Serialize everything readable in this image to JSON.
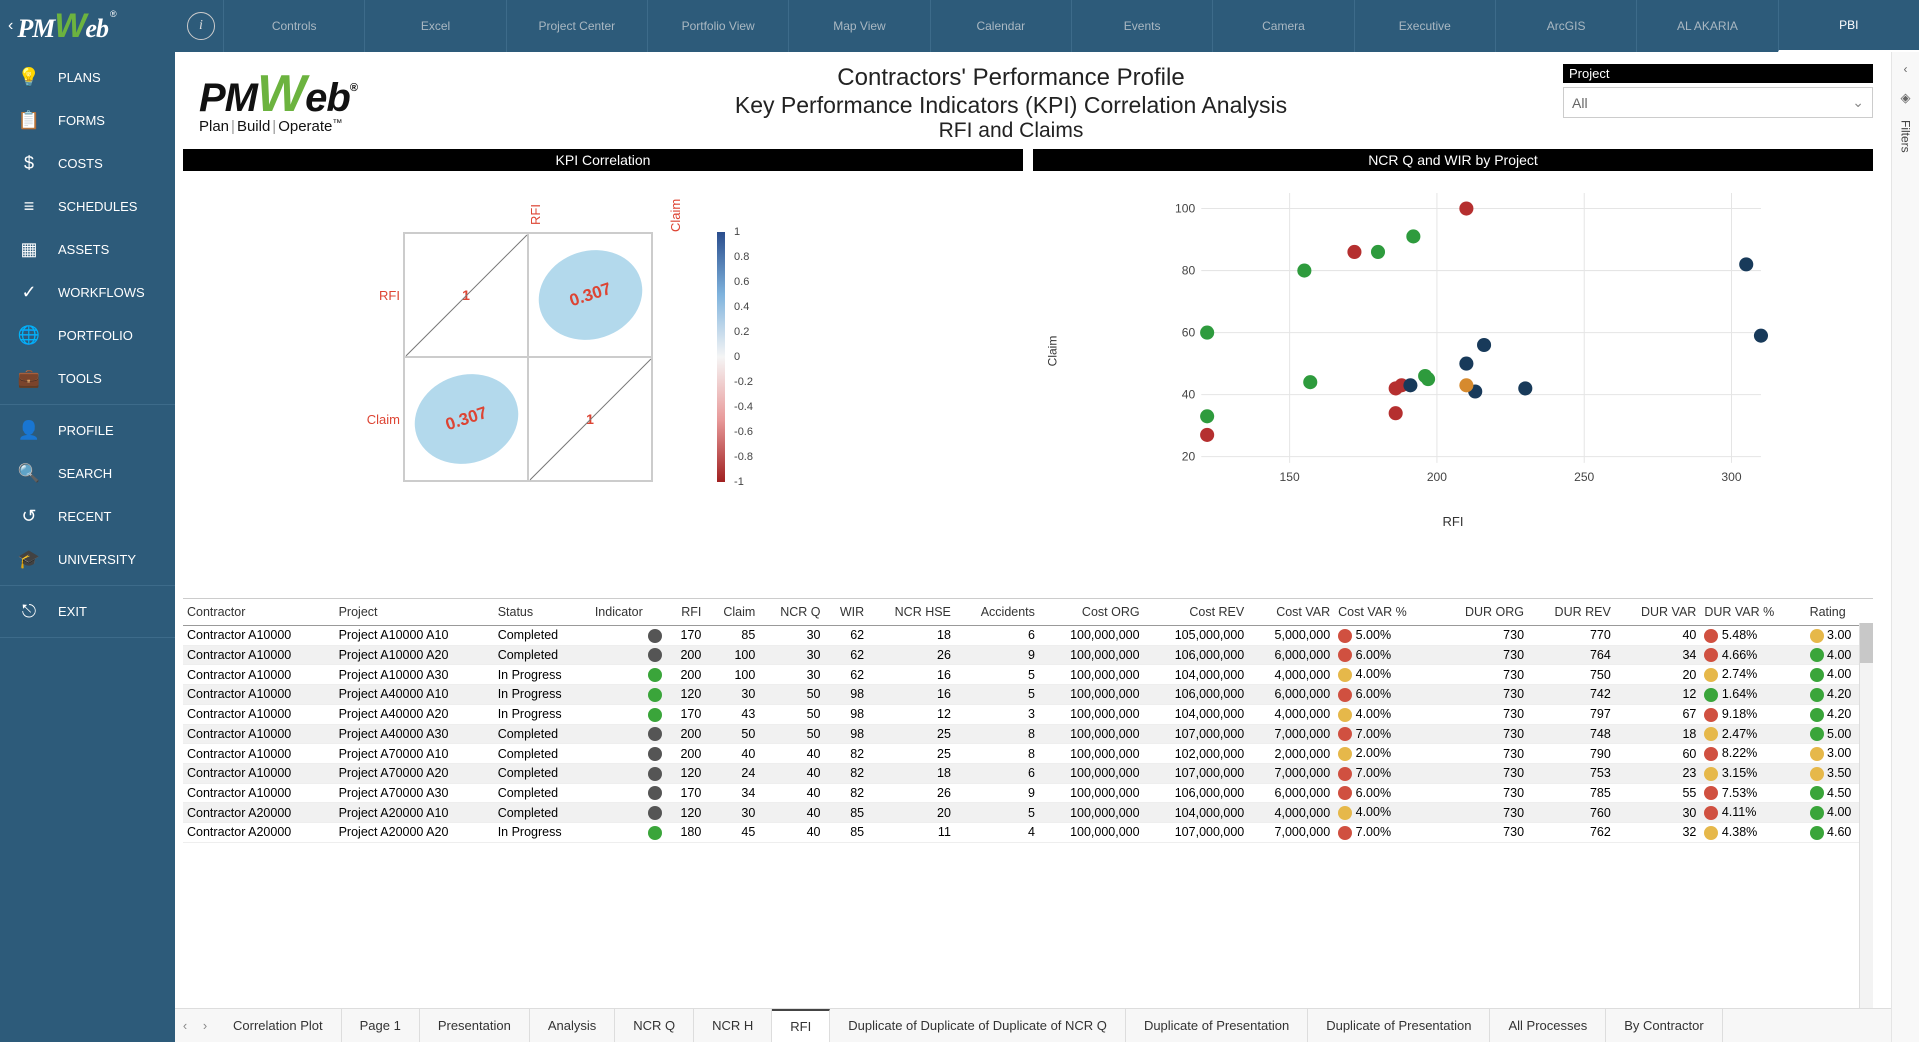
{
  "topnav": [
    "Controls",
    "Excel",
    "Project Center",
    "Portfolio View",
    "Map View",
    "Calendar",
    "Events",
    "Camera",
    "Executive",
    "ArcGIS",
    "AL AKARIA",
    "PBI"
  ],
  "topnav_active": "PBI",
  "sidebar": {
    "group1": [
      "PLANS",
      "FORMS",
      "COSTS",
      "SCHEDULES",
      "ASSETS",
      "WORKFLOWS",
      "PORTFOLIO",
      "TOOLS"
    ],
    "group2": [
      "PROFILE",
      "SEARCH",
      "RECENT",
      "UNIVERSITY"
    ],
    "group3": [
      "EXIT"
    ]
  },
  "sidebar_icons": {
    "PLANS": "lightbulb-icon",
    "FORMS": "clipboard-icon",
    "COSTS": "dollar-icon",
    "SCHEDULES": "bars-icon",
    "ASSETS": "grid-icon",
    "WORKFLOWS": "check-icon",
    "PORTFOLIO": "globe-icon",
    "TOOLS": "briefcase-icon",
    "PROFILE": "user-icon",
    "SEARCH": "search-icon",
    "RECENT": "history-icon",
    "UNIVERSITY": "graduate-icon",
    "EXIT": "exit-icon"
  },
  "header": {
    "logo_tagline_parts": [
      "Plan",
      "Build",
      "Operate"
    ],
    "logo_tagline_tm": "™",
    "title_l1": "Contractors' Performance Profile",
    "title_l2": "Key Performance Indicators (KPI) Correlation Analysis",
    "title_l3": "RFI and Claims",
    "filter_label": "Project",
    "filter_value": "All"
  },
  "filters_rail_label": "Filters",
  "chart_left_title": "KPI Correlation",
  "chart_right_title": "NCR Q and WIR by Project",
  "chart_data": [
    {
      "type": "heatmap",
      "title": "KPI Correlation",
      "labels": [
        "RFI",
        "Claim"
      ],
      "matrix": [
        [
          1,
          0.307
        ],
        [
          0.307,
          1
        ]
      ],
      "colorbar_ticks": [
        "1",
        "0.8",
        "0.6",
        "0.4",
        "0.2",
        "0",
        "-0.2",
        "-0.4",
        "-0.6",
        "-0.8",
        "-1"
      ]
    },
    {
      "type": "scatter",
      "title": "NCR Q and WIR by Project",
      "xlabel": "RFI",
      "ylabel": "Claim",
      "xticks": [
        150,
        200,
        250,
        300
      ],
      "yticks": [
        20,
        40,
        60,
        80,
        100
      ],
      "xlim": [
        120,
        310
      ],
      "ylim": [
        18,
        105
      ],
      "series": [
        {
          "name": "green",
          "color": "#2e9b3d",
          "points": [
            [
              122,
              60
            ],
            [
              122,
              33
            ],
            [
              155,
              80
            ],
            [
              157,
              44
            ],
            [
              180,
              86
            ],
            [
              192,
              91
            ],
            [
              196,
              46
            ],
            [
              197,
              45
            ]
          ]
        },
        {
          "name": "red",
          "color": "#b52f2f",
          "points": [
            [
              122,
              27
            ],
            [
              172,
              86
            ],
            [
              186,
              42
            ],
            [
              188,
              43
            ],
            [
              186,
              34
            ],
            [
              210,
              100
            ]
          ]
        },
        {
          "name": "navy",
          "color": "#183a5a",
          "points": [
            [
              191,
              43
            ],
            [
              210,
              50
            ],
            [
              213,
              41
            ],
            [
              216,
              56
            ],
            [
              230,
              42
            ],
            [
              305,
              82
            ],
            [
              310,
              59
            ]
          ]
        },
        {
          "name": "orange",
          "color": "#d68a2e",
          "points": [
            [
              210,
              43
            ]
          ]
        }
      ]
    }
  ],
  "table": {
    "columns": [
      "Contractor",
      "Project",
      "Status",
      "Indicator",
      "RFI",
      "Claim",
      "NCR Q",
      "WIR",
      "NCR HSE",
      "Accidents",
      "Cost ORG",
      "Cost REV",
      "Cost VAR",
      "Cost VAR %",
      "DUR ORG",
      "DUR REV",
      "DUR VAR",
      "DUR VAR %",
      "Rating"
    ],
    "align": [
      "l",
      "l",
      "l",
      "c",
      "r",
      "r",
      "r",
      "r",
      "r",
      "r",
      "r",
      "r",
      "r",
      "l",
      "r",
      "r",
      "r",
      "l",
      "l"
    ],
    "rows": [
      {
        "Contractor": "Contractor A10000",
        "Project": "Project A10000 A10",
        "Status": "Completed",
        "Indicator": "#555",
        "RFI": 170,
        "Claim": 85,
        "NCR Q": 30,
        "WIR": 62,
        "NCR HSE": 18,
        "Accidents": 6,
        "Cost ORG": "100,000,000",
        "Cost REV": "105,000,000",
        "Cost VAR": "5,000,000",
        "Cost VAR %": "5.00%",
        "cvc": "#d05040",
        "DUR ORG": 730,
        "DUR REV": 770,
        "DUR VAR": 40,
        "DUR VAR %": "5.48%",
        "dvc": "#d05040",
        "Rating": "3.00",
        "rc": "#e6b84a"
      },
      {
        "Contractor": "Contractor A10000",
        "Project": "Project A10000 A20",
        "Status": "Completed",
        "Indicator": "#555",
        "RFI": 200,
        "Claim": 100,
        "NCR Q": 30,
        "WIR": 62,
        "NCR HSE": 26,
        "Accidents": 9,
        "Cost ORG": "100,000,000",
        "Cost REV": "106,000,000",
        "Cost VAR": "6,000,000",
        "Cost VAR %": "6.00%",
        "cvc": "#d05040",
        "DUR ORG": 730,
        "DUR REV": 764,
        "DUR VAR": 34,
        "DUR VAR %": "4.66%",
        "dvc": "#d05040",
        "Rating": "4.00",
        "rc": "#3aa53a"
      },
      {
        "Contractor": "Contractor A10000",
        "Project": "Project A10000 A30",
        "Status": "In Progress",
        "Indicator": "#3aa53a",
        "RFI": 200,
        "Claim": 100,
        "NCR Q": 30,
        "WIR": 62,
        "NCR HSE": 16,
        "Accidents": 5,
        "Cost ORG": "100,000,000",
        "Cost REV": "104,000,000",
        "Cost VAR": "4,000,000",
        "Cost VAR %": "4.00%",
        "cvc": "#e6b84a",
        "DUR ORG": 730,
        "DUR REV": 750,
        "DUR VAR": 20,
        "DUR VAR %": "2.74%",
        "dvc": "#e6b84a",
        "Rating": "4.00",
        "rc": "#3aa53a"
      },
      {
        "Contractor": "Contractor A10000",
        "Project": "Project A40000 A10",
        "Status": "In Progress",
        "Indicator": "#3aa53a",
        "RFI": 120,
        "Claim": 30,
        "NCR Q": 50,
        "WIR": 98,
        "NCR HSE": 16,
        "Accidents": 5,
        "Cost ORG": "100,000,000",
        "Cost REV": "106,000,000",
        "Cost VAR": "6,000,000",
        "Cost VAR %": "6.00%",
        "cvc": "#d05040",
        "DUR ORG": 730,
        "DUR REV": 742,
        "DUR VAR": 12,
        "DUR VAR %": "1.64%",
        "dvc": "#3aa53a",
        "Rating": "4.20",
        "rc": "#3aa53a"
      },
      {
        "Contractor": "Contractor A10000",
        "Project": "Project A40000 A20",
        "Status": "In Progress",
        "Indicator": "#3aa53a",
        "RFI": 170,
        "Claim": 43,
        "NCR Q": 50,
        "WIR": 98,
        "NCR HSE": 12,
        "Accidents": 3,
        "Cost ORG": "100,000,000",
        "Cost REV": "104,000,000",
        "Cost VAR": "4,000,000",
        "Cost VAR %": "4.00%",
        "cvc": "#e6b84a",
        "DUR ORG": 730,
        "DUR REV": 797,
        "DUR VAR": 67,
        "DUR VAR %": "9.18%",
        "dvc": "#d05040",
        "Rating": "4.20",
        "rc": "#3aa53a"
      },
      {
        "Contractor": "Contractor A10000",
        "Project": "Project A40000 A30",
        "Status": "Completed",
        "Indicator": "#555",
        "RFI": 200,
        "Claim": 50,
        "NCR Q": 50,
        "WIR": 98,
        "NCR HSE": 25,
        "Accidents": 8,
        "Cost ORG": "100,000,000",
        "Cost REV": "107,000,000",
        "Cost VAR": "7,000,000",
        "Cost VAR %": "7.00%",
        "cvc": "#d05040",
        "DUR ORG": 730,
        "DUR REV": 748,
        "DUR VAR": 18,
        "DUR VAR %": "2.47%",
        "dvc": "#e6b84a",
        "Rating": "5.00",
        "rc": "#3aa53a"
      },
      {
        "Contractor": "Contractor A10000",
        "Project": "Project A70000 A10",
        "Status": "Completed",
        "Indicator": "#555",
        "RFI": 200,
        "Claim": 40,
        "NCR Q": 40,
        "WIR": 82,
        "NCR HSE": 25,
        "Accidents": 8,
        "Cost ORG": "100,000,000",
        "Cost REV": "102,000,000",
        "Cost VAR": "2,000,000",
        "Cost VAR %": "2.00%",
        "cvc": "#e6b84a",
        "DUR ORG": 730,
        "DUR REV": 790,
        "DUR VAR": 60,
        "DUR VAR %": "8.22%",
        "dvc": "#d05040",
        "Rating": "3.00",
        "rc": "#e6b84a"
      },
      {
        "Contractor": "Contractor A10000",
        "Project": "Project A70000 A20",
        "Status": "Completed",
        "Indicator": "#555",
        "RFI": 120,
        "Claim": 24,
        "NCR Q": 40,
        "WIR": 82,
        "NCR HSE": 18,
        "Accidents": 6,
        "Cost ORG": "100,000,000",
        "Cost REV": "107,000,000",
        "Cost VAR": "7,000,000",
        "Cost VAR %": "7.00%",
        "cvc": "#d05040",
        "DUR ORG": 730,
        "DUR REV": 753,
        "DUR VAR": 23,
        "DUR VAR %": "3.15%",
        "dvc": "#e6b84a",
        "Rating": "3.50",
        "rc": "#e6b84a"
      },
      {
        "Contractor": "Contractor A10000",
        "Project": "Project A70000 A30",
        "Status": "Completed",
        "Indicator": "#555",
        "RFI": 170,
        "Claim": 34,
        "NCR Q": 40,
        "WIR": 82,
        "NCR HSE": 26,
        "Accidents": 9,
        "Cost ORG": "100,000,000",
        "Cost REV": "106,000,000",
        "Cost VAR": "6,000,000",
        "Cost VAR %": "6.00%",
        "cvc": "#d05040",
        "DUR ORG": 730,
        "DUR REV": 785,
        "DUR VAR": 55,
        "DUR VAR %": "7.53%",
        "dvc": "#d05040",
        "Rating": "4.50",
        "rc": "#3aa53a"
      },
      {
        "Contractor": "Contractor A20000",
        "Project": "Project A20000 A10",
        "Status": "Completed",
        "Indicator": "#555",
        "RFI": 120,
        "Claim": 30,
        "NCR Q": 40,
        "WIR": 85,
        "NCR HSE": 20,
        "Accidents": 5,
        "Cost ORG": "100,000,000",
        "Cost REV": "104,000,000",
        "Cost VAR": "4,000,000",
        "Cost VAR %": "4.00%",
        "cvc": "#e6b84a",
        "DUR ORG": 730,
        "DUR REV": 760,
        "DUR VAR": 30,
        "DUR VAR %": "4.11%",
        "dvc": "#d05040",
        "Rating": "4.00",
        "rc": "#3aa53a"
      },
      {
        "Contractor": "Contractor A20000",
        "Project": "Project A20000 A20",
        "Status": "In Progress",
        "Indicator": "#3aa53a",
        "RFI": 180,
        "Claim": 45,
        "NCR Q": 40,
        "WIR": 85,
        "NCR HSE": 11,
        "Accidents": 4,
        "Cost ORG": "100,000,000",
        "Cost REV": "107,000,000",
        "Cost VAR": "7,000,000",
        "Cost VAR %": "7.00%",
        "cvc": "#d05040",
        "DUR ORG": 730,
        "DUR REV": 762,
        "DUR VAR": 32,
        "DUR VAR %": "4.38%",
        "dvc": "#e6b84a",
        "Rating": "4.60",
        "rc": "#3aa53a"
      }
    ]
  },
  "bottom_tabs": [
    "Correlation Plot",
    "Page 1",
    "Presentation",
    "Analysis",
    "NCR Q",
    "NCR H",
    "RFI",
    "Duplicate of Duplicate of Duplicate of NCR Q",
    "Duplicate of Presentation",
    "Duplicate of Presentation",
    "All Processes",
    "By Contractor"
  ],
  "bottom_tab_active": "RFI"
}
